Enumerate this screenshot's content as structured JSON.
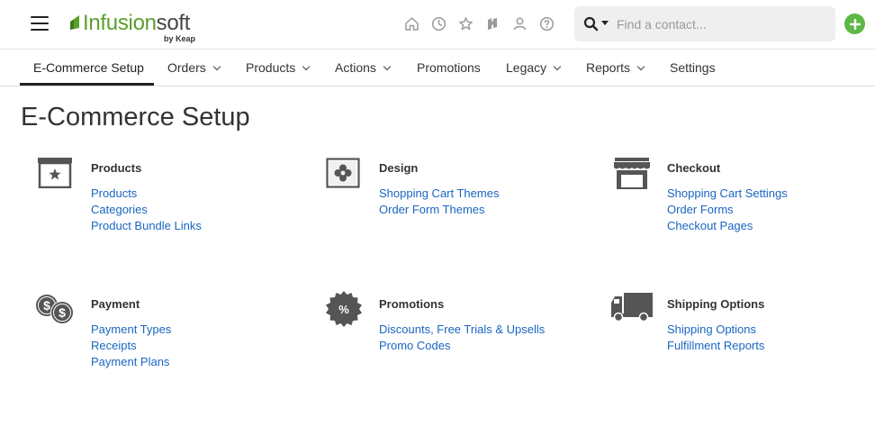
{
  "header": {
    "logo_text_main": "Infusion",
    "logo_text_soft": "soft",
    "logo_sub": "by Keap",
    "icons": [
      "home-icon",
      "clock-icon",
      "star-icon",
      "flag-icon",
      "person-icon",
      "help-icon"
    ],
    "search_placeholder": "Find a contact...",
    "add_button": "+",
    "brand_color": "#5a9f2c",
    "add_color": "#5cb845"
  },
  "nav": {
    "items": [
      {
        "label": "E-Commerce Setup",
        "active": true,
        "dropdown": false
      },
      {
        "label": "Orders",
        "dropdown": true
      },
      {
        "label": "Products",
        "dropdown": true
      },
      {
        "label": "Actions",
        "dropdown": true
      },
      {
        "label": "Promotions",
        "dropdown": false
      },
      {
        "label": "Legacy",
        "dropdown": true
      },
      {
        "label": "Reports",
        "dropdown": true
      },
      {
        "label": "Settings",
        "dropdown": false
      }
    ]
  },
  "page": {
    "title": "E-Commerce Setup",
    "link_color": "#1a66c2"
  },
  "sections": [
    {
      "title": "Products",
      "icon": "product-box-icon",
      "links": [
        "Products",
        "Categories",
        "Product Bundle Links"
      ]
    },
    {
      "title": "Design",
      "icon": "design-flower-icon",
      "links": [
        "Shopping Cart Themes",
        "Order Form Themes"
      ]
    },
    {
      "title": "Checkout",
      "icon": "storefront-icon",
      "links": [
        "Shopping Cart Settings",
        "Order Forms",
        "Checkout Pages"
      ]
    },
    {
      "title": "Payment",
      "icon": "coins-icon",
      "links": [
        "Payment Types",
        "Receipts",
        "Payment Plans"
      ]
    },
    {
      "title": "Promotions",
      "icon": "percent-badge-icon",
      "links": [
        "Discounts, Free Trials & Upsells",
        "Promo Codes"
      ]
    },
    {
      "title": "Shipping Options",
      "icon": "truck-icon",
      "links": [
        "Shipping Options",
        "Fulfillment Reports"
      ]
    }
  ]
}
